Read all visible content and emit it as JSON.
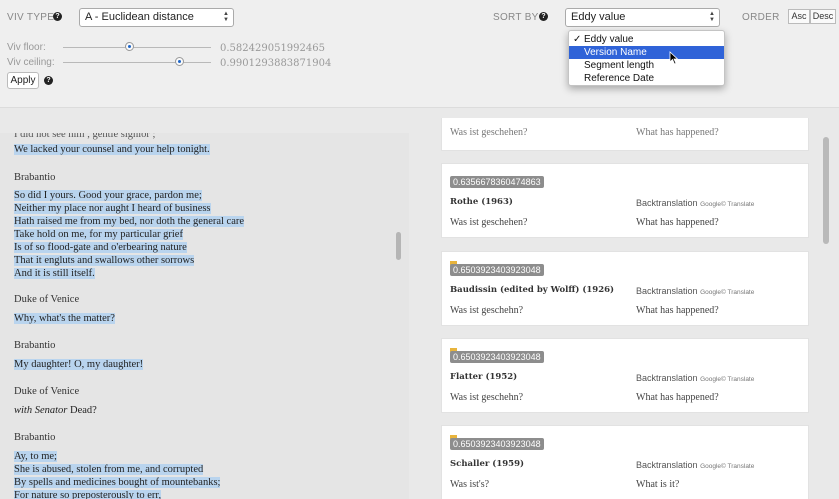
{
  "controls": {
    "viv_type_label": "VIV TYPE",
    "viv_type_value": "A - Euclidean distance",
    "sort_by_label": "SORT BY",
    "sort_by_value": "Eddy value",
    "order_label": "ORDER",
    "order_asc": "Asc",
    "order_desc": "Desc",
    "viv_floor_label": "Viv floor:",
    "viv_floor_value": "0.582429051992465",
    "viv_floor_fraction": 0.45,
    "viv_ceiling_label": "Viv ceiling:",
    "viv_ceiling_value": "0.9901293883871904",
    "viv_ceiling_fraction": 0.79,
    "apply_label": "Apply"
  },
  "sort_menu": {
    "items": [
      "Eddy value",
      "Version Name",
      "Segment length",
      "Reference Date"
    ],
    "checked_index": 0,
    "highlighted_index": 1,
    "check_glyph": "✓"
  },
  "source_text": {
    "top_partial": "I did not see him , gentle signior ;",
    "top_line": "We lacked your counsel and your help tonight.",
    "speeches": [
      {
        "speaker": "Brabantio",
        "lines": [
          "So did I yours. Good your grace, pardon me;",
          "Neither my place nor aught I heard of business",
          "Hath raised me from my bed, nor doth the general care",
          "Take hold on me, for my particular grief",
          "Is of so flood-gate and o'erbearing nature",
          "That it engluts and swallows other sorrows",
          "And it is still itself."
        ]
      },
      {
        "speaker": "Duke of Venice",
        "lines": [
          "Why, what's the matter?"
        ]
      },
      {
        "speaker": "Brabantio",
        "lines": [
          "My daughter! O, my daughter!"
        ]
      },
      {
        "speaker": "Duke of Venice",
        "stage": "with Senator",
        "lines": [
          "Dead?"
        ]
      },
      {
        "speaker": "Brabantio",
        "lines": [
          "Ay, to me;",
          "She is abused, stolen from me, and corrupted",
          "By spells and medicines bought of mountebanks;",
          "For nature so preposterously to err,"
        ]
      }
    ]
  },
  "versions": {
    "partial_top": {
      "text": "Was ist geschehen?",
      "back": "What has happened?"
    },
    "backtranslation_label": "Backtranslation",
    "google_label": "Google© Translate",
    "cards": [
      {
        "score": "0.6356678360474863",
        "flag": false,
        "name": "Rothe (1963)",
        "text": "Was ist geschehen?",
        "back": "What has happened?"
      },
      {
        "score": "0.6503923403923048",
        "flag": true,
        "name": "Baudissin (edited by Wolff) (1926)",
        "text": "Was ist geschehn?",
        "back": "What has happened?"
      },
      {
        "score": "0.6503923403923048",
        "flag": true,
        "name": "Flatter (1952)",
        "text": "Was ist geschehn?",
        "back": "What has happened?"
      },
      {
        "score": "0.6503923403923048",
        "flag": true,
        "name": "Schaller (1959)",
        "text": "Was ist's?",
        "back": "What is it?"
      }
    ]
  },
  "colors": {
    "highlight": "#b9d4ee",
    "menu_selection": "#2f63d8",
    "flag": "#e8b43c",
    "badge": "#8d8d8d"
  }
}
